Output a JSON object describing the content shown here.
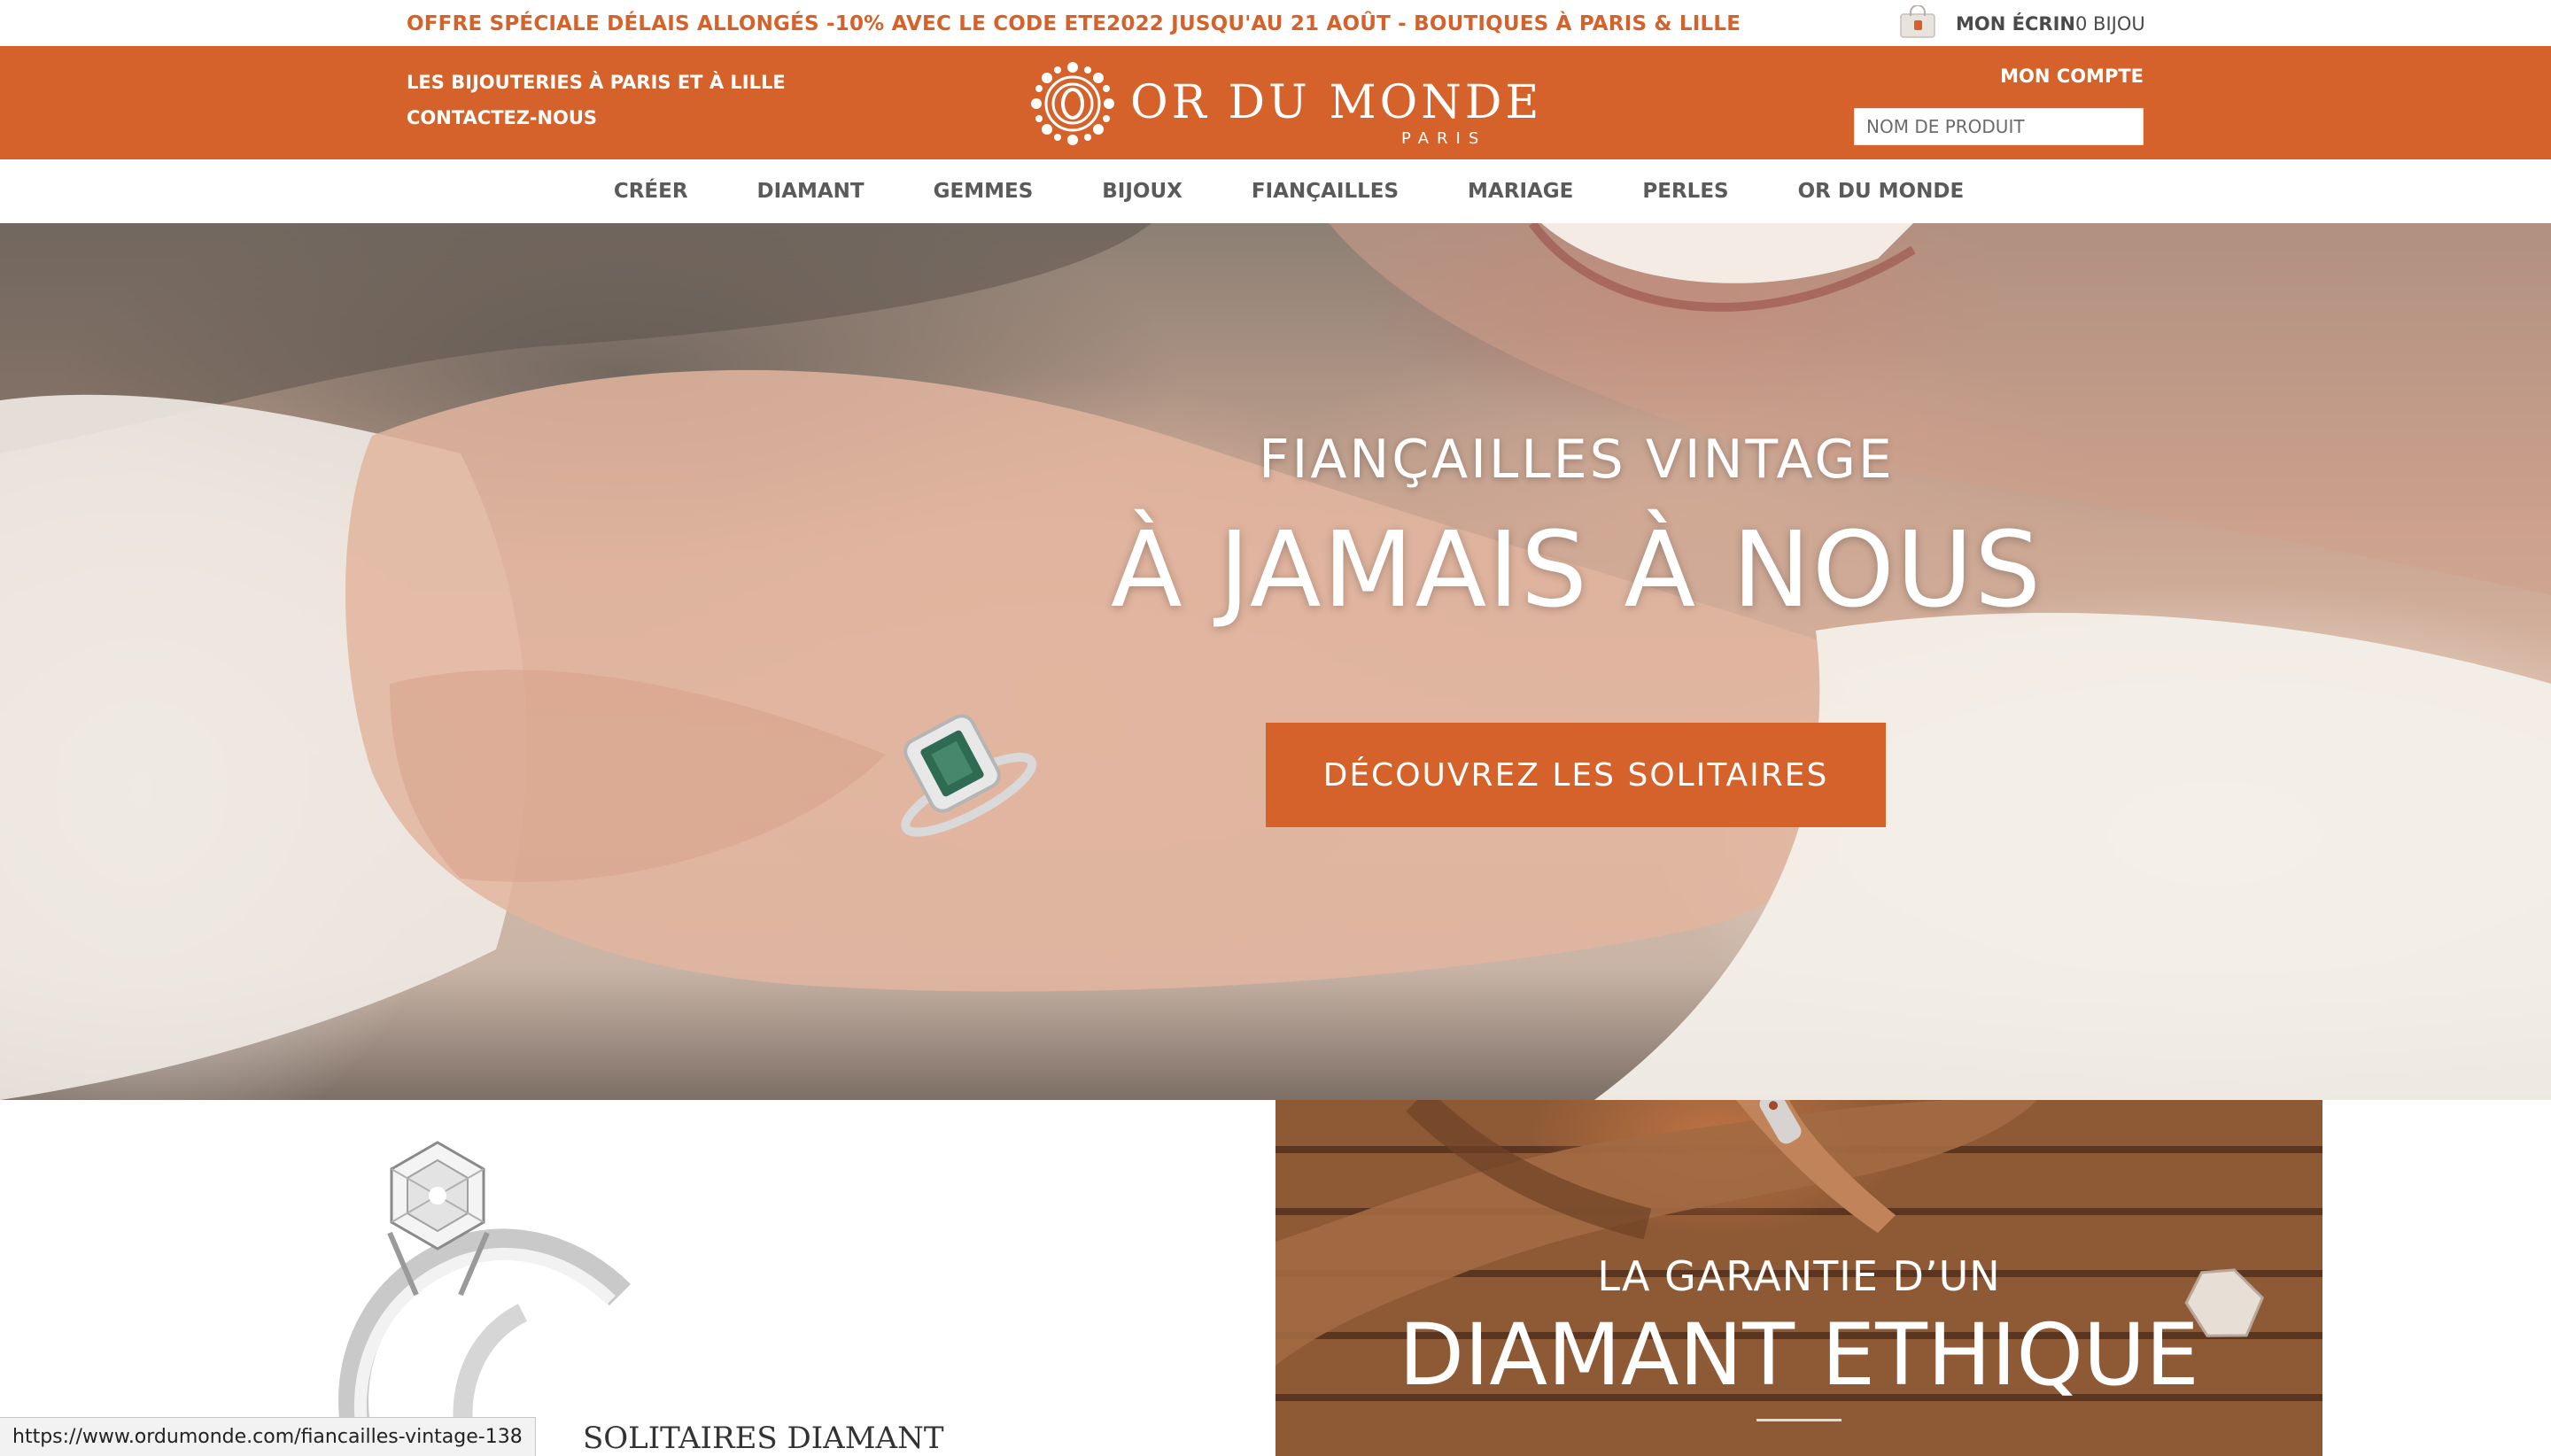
{
  "promo": {
    "text": "OFFRE SPÉCIALE DÉLAIS ALLONGÉS -10% AVEC LE CODE ETE2022 JUSQU'AU 21 AOÛT - BOUTIQUES À PARIS & LILLE"
  },
  "cart": {
    "icon": "shopping-bag-icon",
    "label": "MON ÉCRIN",
    "count": "0 BIJOU"
  },
  "header": {
    "stores_link": "LES BIJOUTERIES À PARIS ET À LILLE",
    "contact_link": "CONTACTEZ-NOUS",
    "logo_name": "OR DU MONDE",
    "logo_sub": "PARIS",
    "account_link": "MON COMPTE",
    "search_placeholder": "NOM DE PRODUIT"
  },
  "nav": {
    "items": [
      "CRÉER",
      "DIAMANT",
      "GEMMES",
      "BIJOUX",
      "FIANÇAILLES",
      "MARIAGE",
      "PERLES",
      "OR DU MONDE"
    ]
  },
  "hero": {
    "kicker": "FIANÇAILLES VINTAGE",
    "title": "À JAMAIS À NOUS",
    "cta": "DÉCOUVREZ LES SOLITAIRES"
  },
  "promos": {
    "solitaire_title": "SOLITAIRES DIAMANT",
    "ethics_kicker": "LA GARANTIE D’UN",
    "ethics_title": "DIAMANT ETHIQUE"
  },
  "status": {
    "url": "https://www.ordumonde.com/fiancailles-vintage-138"
  },
  "colors": {
    "brand_orange": "#d4622a",
    "nav_text": "#5a5a5a",
    "white": "#ffffff"
  }
}
